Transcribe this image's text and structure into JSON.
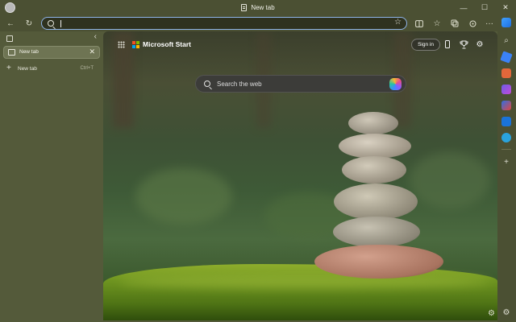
{
  "window": {
    "title": "New tab",
    "controls": [
      "—",
      "☐",
      "✕"
    ]
  },
  "toolbar": {
    "back_icon": "←",
    "refresh_icon": "↻",
    "address_value": "",
    "right_icons": [
      "split-screen-icon",
      "favorites-icon",
      "collections-icon",
      "extensions-icon",
      "more-icon"
    ],
    "more_label": "···"
  },
  "sidebar": {
    "tabs": [
      {
        "label": "New tab",
        "active": true
      }
    ],
    "new_tab_label": "New tab",
    "new_tab_shortcut": "Ctrl+T"
  },
  "newtab": {
    "brand": "Microsoft Start",
    "signin_label": "Sign in",
    "search_placeholder": "Search the web"
  },
  "rail": {
    "icons": [
      "copilot-icon",
      "search-icon",
      "shopping-icon",
      "tools-icon",
      "games-icon",
      "office-icon",
      "outlook-icon",
      "telegram-icon",
      "add-icon",
      "settings-icon"
    ]
  },
  "colors": {
    "frame": "#4b5033",
    "sidebar": "#545a3a",
    "accent_border": "#8fb4e8"
  }
}
